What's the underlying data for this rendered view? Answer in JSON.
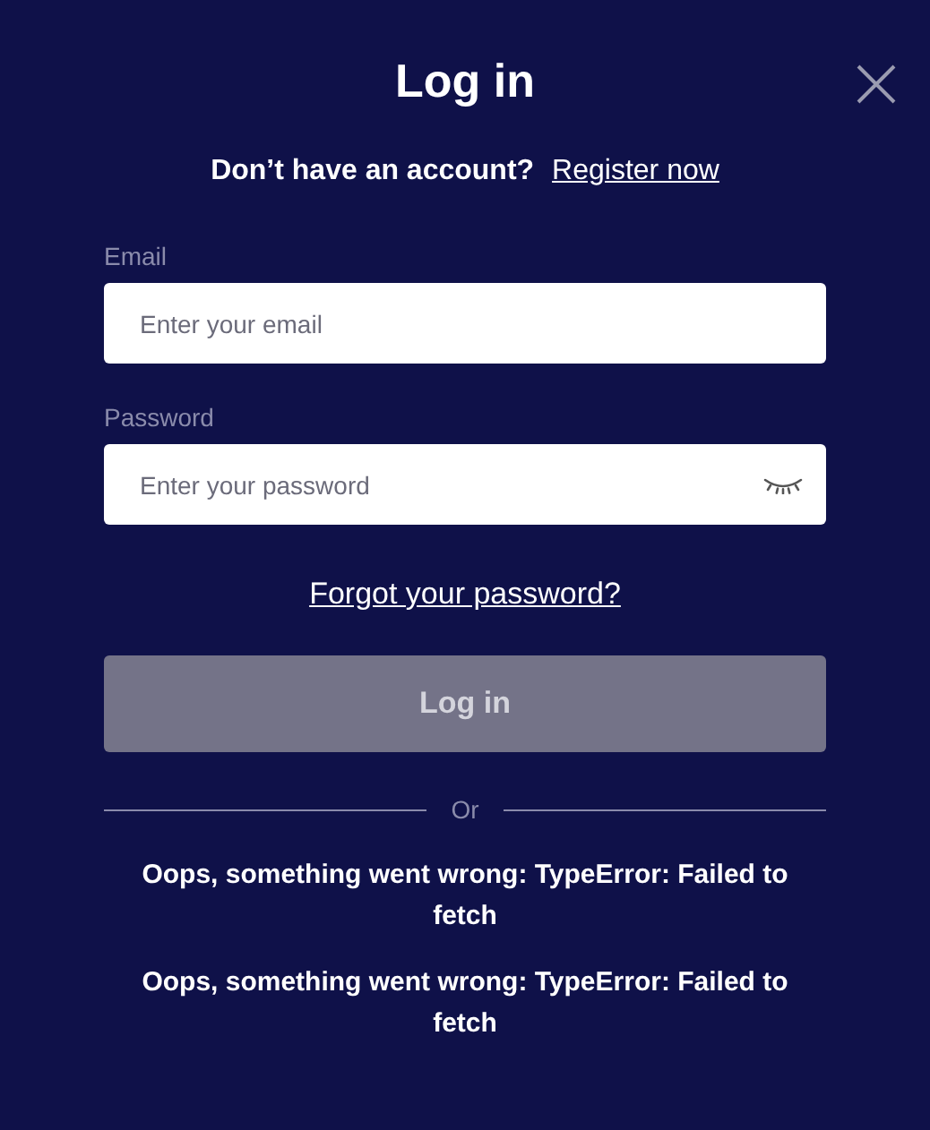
{
  "title": "Log in",
  "register_prompt": {
    "text": "Don’t have an account?",
    "link": "Register now"
  },
  "fields": [
    {
      "label": "Email",
      "placeholder": "Enter your email",
      "kind": "email"
    },
    {
      "label": "Password",
      "placeholder": "Enter your password",
      "kind": "password"
    }
  ],
  "forgot_link": "Forgot your password?",
  "submit_button": {
    "label": "Log in",
    "disabled": true
  },
  "divider_label": "Or",
  "errors": [
    "Oops, something went wrong: TypeError: Failed to fetch",
    "Oops, something went wrong: TypeError: Failed to fetch"
  ]
}
